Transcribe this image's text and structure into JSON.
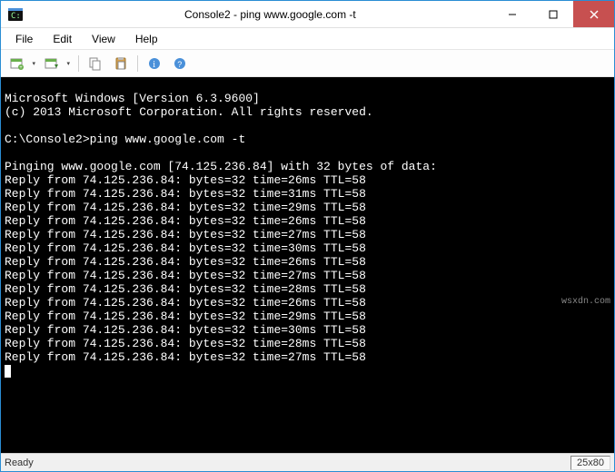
{
  "window": {
    "title": "Console2 - ping  www.google.com -t"
  },
  "menu": {
    "file": "File",
    "edit": "Edit",
    "view": "View",
    "help": "Help"
  },
  "console": {
    "header_line1": "Microsoft Windows [Version 6.3.9600]",
    "header_line2": "(c) 2013 Microsoft Corporation. All rights reserved.",
    "prompt": "C:\\Console2>",
    "command": "ping www.google.com -t",
    "pinging": "Pinging www.google.com [74.125.236.84] with 32 bytes of data:",
    "replies": [
      "Reply from 74.125.236.84: bytes=32 time=26ms TTL=58",
      "Reply from 74.125.236.84: bytes=32 time=31ms TTL=58",
      "Reply from 74.125.236.84: bytes=32 time=29ms TTL=58",
      "Reply from 74.125.236.84: bytes=32 time=26ms TTL=58",
      "Reply from 74.125.236.84: bytes=32 time=27ms TTL=58",
      "Reply from 74.125.236.84: bytes=32 time=30ms TTL=58",
      "Reply from 74.125.236.84: bytes=32 time=26ms TTL=58",
      "Reply from 74.125.236.84: bytes=32 time=27ms TTL=58",
      "Reply from 74.125.236.84: bytes=32 time=28ms TTL=58",
      "Reply from 74.125.236.84: bytes=32 time=26ms TTL=58",
      "Reply from 74.125.236.84: bytes=32 time=29ms TTL=58",
      "Reply from 74.125.236.84: bytes=32 time=30ms TTL=58",
      "Reply from 74.125.236.84: bytes=32 time=28ms TTL=58",
      "Reply from 74.125.236.84: bytes=32 time=27ms TTL=58"
    ]
  },
  "status": {
    "left": "Ready",
    "right": "25x80"
  },
  "watermark": "wsxdn.com"
}
